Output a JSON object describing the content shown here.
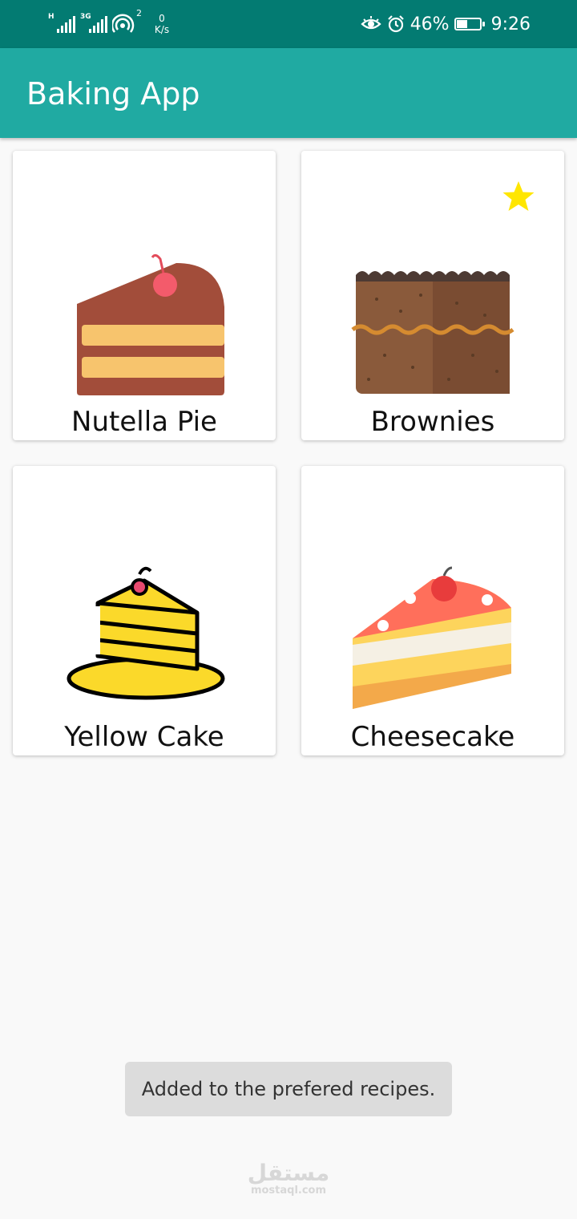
{
  "status_bar": {
    "sim1_type": "H",
    "sim2_type": "3G",
    "hotspot_count": "2",
    "net_speed_value": "0",
    "net_speed_unit": "K/s",
    "battery_percent_text": "46%",
    "battery_level": 0.46,
    "time": "9:26"
  },
  "app_bar": {
    "title": "Baking App",
    "color": "#20aaa2"
  },
  "recipes": [
    {
      "name": "Nutella Pie",
      "image": "nutella-pie-icon",
      "favorite": false
    },
    {
      "name": "Brownies",
      "image": "brownies-icon",
      "favorite": true
    },
    {
      "name": "Yellow Cake",
      "image": "yellow-cake-icon",
      "favorite": false
    },
    {
      "name": "Cheesecake",
      "image": "cheesecake-icon",
      "favorite": false
    }
  ],
  "toast": {
    "message": "Added to the prefered recipes."
  },
  "watermark": {
    "arabic": "مستقل",
    "latin": "mostaql.com"
  },
  "colors": {
    "status_bar": "#037b72",
    "favorite_star": "#ffe600"
  }
}
